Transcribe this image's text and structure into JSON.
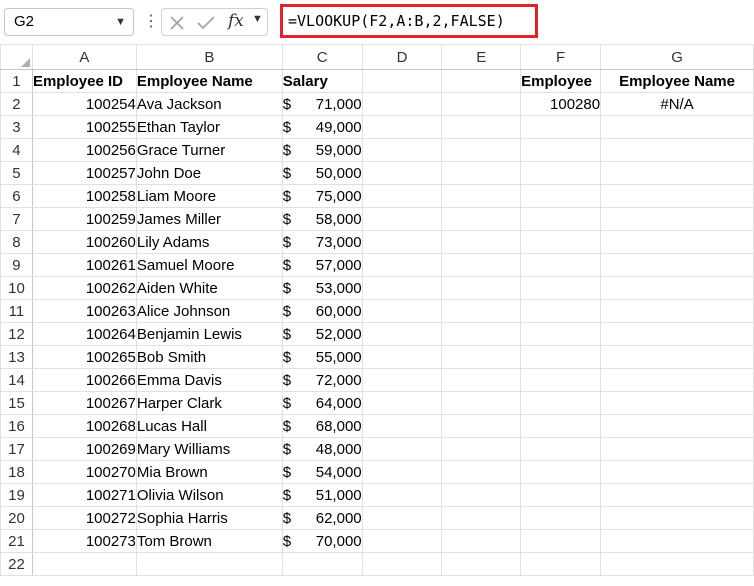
{
  "formula_bar": {
    "name_box": "G2",
    "fx_label": "fx",
    "formula": "=VLOOKUP(F2,A:B,2,FALSE)"
  },
  "columns": [
    "A",
    "B",
    "C",
    "D",
    "E",
    "F",
    "G"
  ],
  "header_row": {
    "row_number": "1",
    "a": "Employee ID",
    "b": "Employee Name",
    "c": "Salary",
    "f": "Employee",
    "g": "Employee Name"
  },
  "lookup": {
    "f2": "100280",
    "g2": "#N/A"
  },
  "currency_symbol": "$",
  "rows": [
    {
      "row": "2",
      "id": "100254",
      "name": "Ava Jackson",
      "salary": "71,000"
    },
    {
      "row": "3",
      "id": "100255",
      "name": "Ethan Taylor",
      "salary": "49,000"
    },
    {
      "row": "4",
      "id": "100256",
      "name": "Grace Turner",
      "salary": "59,000"
    },
    {
      "row": "5",
      "id": "100257",
      "name": "John Doe",
      "salary": "50,000"
    },
    {
      "row": "6",
      "id": "100258",
      "name": "Liam Moore",
      "salary": "75,000"
    },
    {
      "row": "7",
      "id": "100259",
      "name": "James Miller",
      "salary": "58,000"
    },
    {
      "row": "8",
      "id": "100260",
      "name": "Lily Adams",
      "salary": "73,000"
    },
    {
      "row": "9",
      "id": "100261",
      "name": "Samuel Moore",
      "salary": "57,000"
    },
    {
      "row": "10",
      "id": "100262",
      "name": "Aiden White",
      "salary": "53,000"
    },
    {
      "row": "11",
      "id": "100263",
      "name": "Alice Johnson",
      "salary": "60,000"
    },
    {
      "row": "12",
      "id": "100264",
      "name": "Benjamin Lewis",
      "salary": "52,000"
    },
    {
      "row": "13",
      "id": "100265",
      "name": "Bob Smith",
      "salary": "55,000"
    },
    {
      "row": "14",
      "id": "100266",
      "name": "Emma Davis",
      "salary": "72,000"
    },
    {
      "row": "15",
      "id": "100267",
      "name": "Harper Clark",
      "salary": "64,000"
    },
    {
      "row": "16",
      "id": "100268",
      "name": "Lucas Hall",
      "salary": "68,000"
    },
    {
      "row": "17",
      "id": "100269",
      "name": "Mary Williams",
      "salary": "48,000"
    },
    {
      "row": "18",
      "id": "100270",
      "name": "Mia Brown",
      "salary": "54,000"
    },
    {
      "row": "19",
      "id": "100271",
      "name": "Olivia Wilson",
      "salary": "51,000"
    },
    {
      "row": "20",
      "id": "100272",
      "name": "Sophia Harris",
      "salary": "62,000"
    },
    {
      "row": "21",
      "id": "100273",
      "name": "Tom Brown",
      "salary": "70,000"
    }
  ],
  "trailing_rows": [
    "22"
  ],
  "colors": {
    "highlight_border": "#e0232b",
    "table_border": "#8fb9cc"
  }
}
